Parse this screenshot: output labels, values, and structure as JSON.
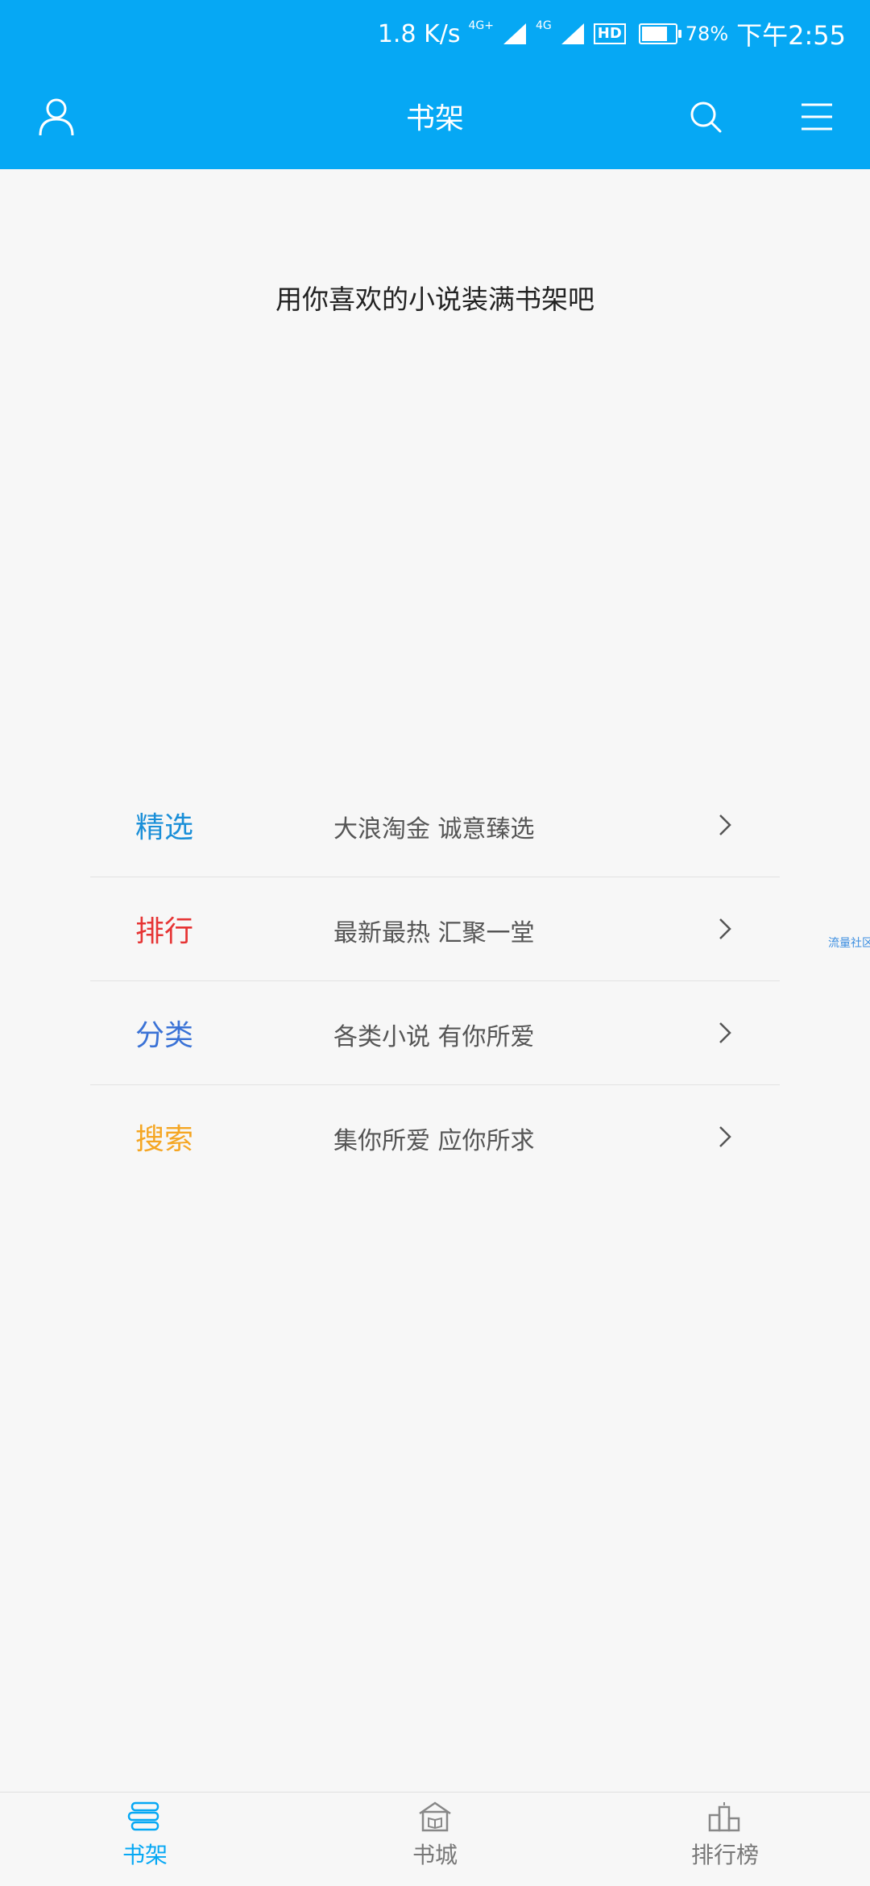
{
  "status_bar": {
    "speed": "1.8 K/s",
    "net1": "4G+",
    "net2": "4G",
    "hd": "HD",
    "battery_pct": "78%",
    "battery_level": 0.78,
    "time": "下午2:55"
  },
  "header": {
    "title": "书架",
    "icons": [
      "user-icon",
      "search-icon",
      "menu-icon"
    ]
  },
  "empty_message": "用你喜欢的小说装满书架吧",
  "menu": {
    "items": [
      {
        "label": "精选",
        "desc": "大浪淘金  诚意臻选",
        "color": "#1a8fd8"
      },
      {
        "label": "排行",
        "desc": "最新最热  汇聚一堂",
        "color": "#e63434"
      },
      {
        "label": "分类",
        "desc": "各类小说  有你所爱",
        "color": "#3a72d6"
      },
      {
        "label": "搜索",
        "desc": "集你所爱  应你所求",
        "color": "#f5a623"
      }
    ]
  },
  "side_tag": "流量社区",
  "bottom_nav": {
    "items": [
      {
        "label": "书架",
        "icon": "bookshelf-icon",
        "active": true
      },
      {
        "label": "书城",
        "icon": "bookstore-icon",
        "active": false
      },
      {
        "label": "排行榜",
        "icon": "ranking-icon",
        "active": false
      }
    ]
  },
  "colors": {
    "accent": "#06a8f4",
    "background": "#f7f7f7"
  }
}
